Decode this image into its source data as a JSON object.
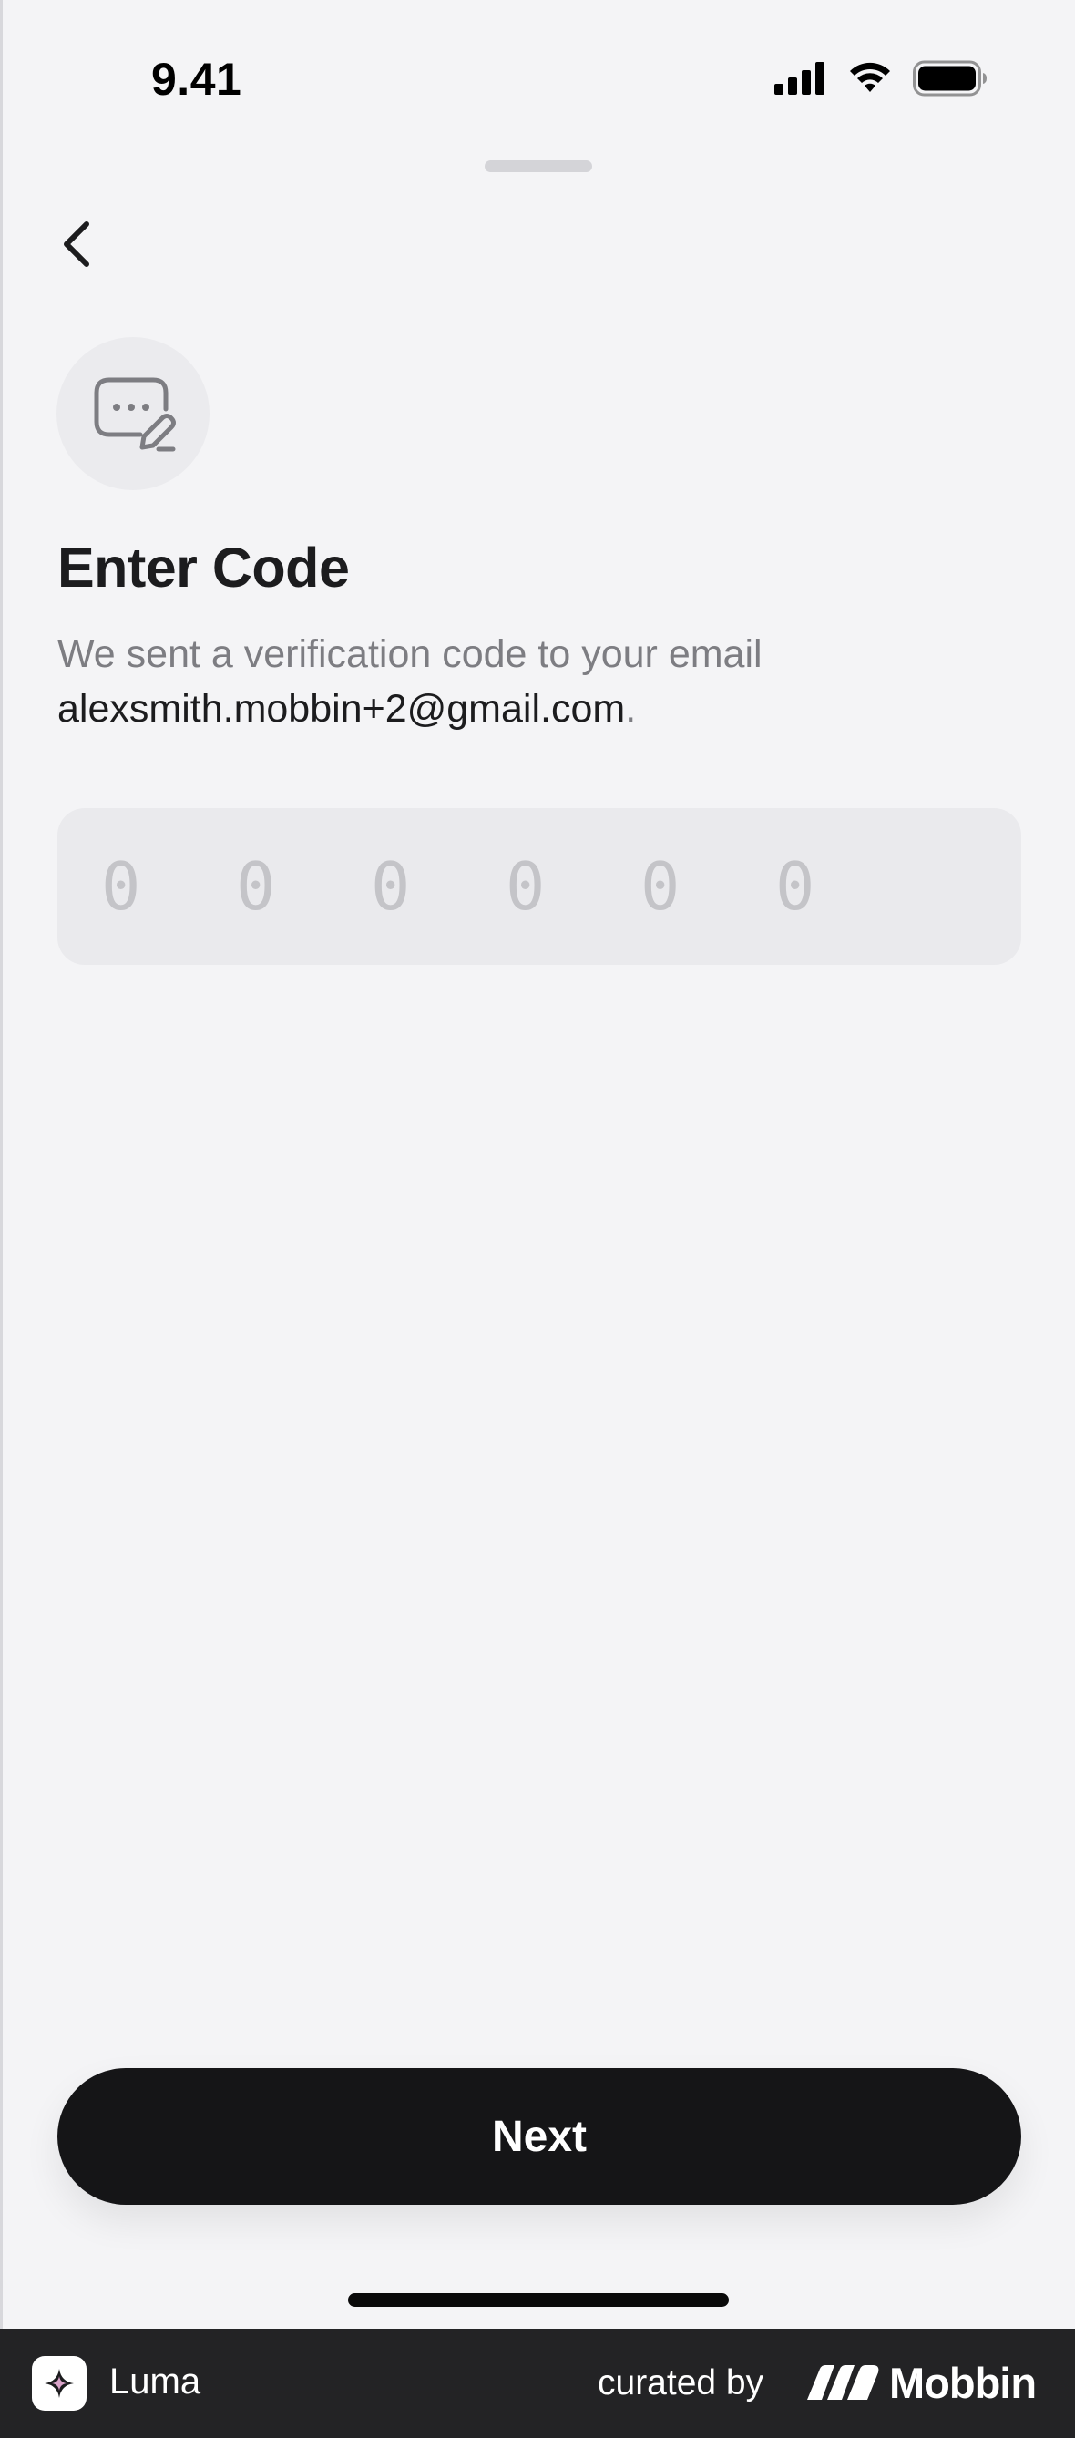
{
  "status_bar": {
    "time": "9.41",
    "icons": [
      "cellular-signal-icon",
      "wifi-icon",
      "battery-icon"
    ]
  },
  "header": {
    "back_icon": "chevron-left-icon"
  },
  "main": {
    "illustration_icon": "message-edit-icon",
    "title": "Enter Code",
    "subtitle": "We sent a verification code to your email",
    "email": "alexsmith.mobbin+2@gmail.com",
    "email_suffix": ".",
    "code_placeholder": [
      "0",
      "0",
      "0",
      "0",
      "0",
      "0"
    ]
  },
  "actions": {
    "next_label": "Next"
  },
  "footer": {
    "app_name": "Luma",
    "curated_label": "curated by",
    "brand": "Mobbin"
  },
  "colors": {
    "background": "#f4f4f6",
    "primary_button": "#151517",
    "secondary_text": "#7d7d82",
    "code_field": "#eaeaed",
    "footer": "#232325"
  }
}
